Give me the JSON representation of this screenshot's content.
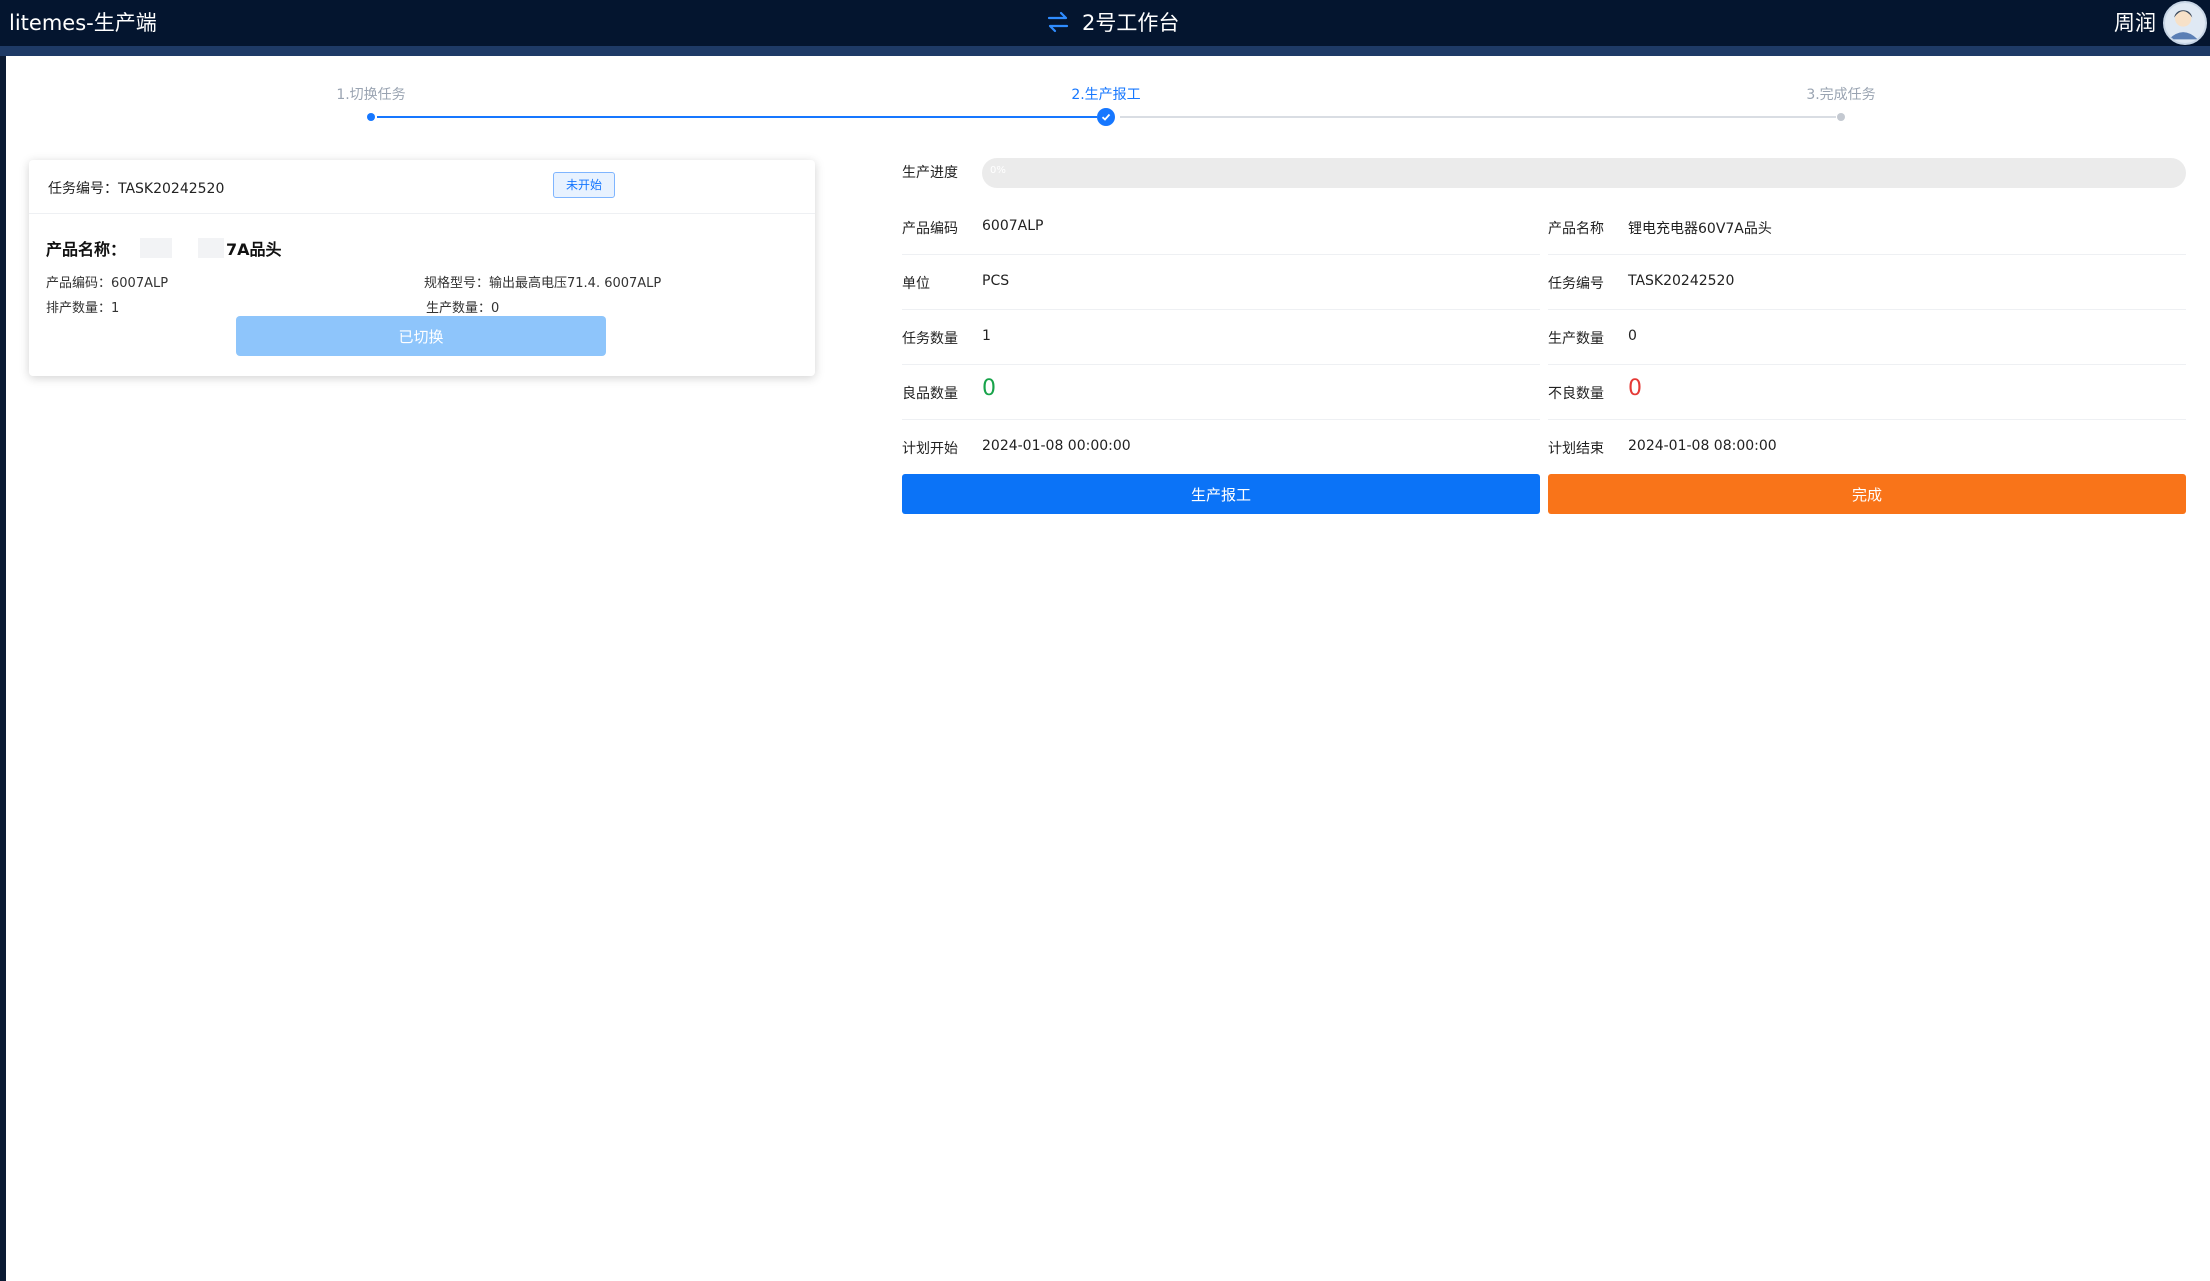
{
  "header": {
    "app_title": "litemes-生产端",
    "workbench": "2号工作台",
    "user_name": "周润"
  },
  "steps": [
    {
      "label": "1.切换任务",
      "state": "done"
    },
    {
      "label": "2.生产报工",
      "state": "active"
    },
    {
      "label": "3.完成任务",
      "state": "todo"
    }
  ],
  "task_card": {
    "task_no": "任务编号：TASK20242520",
    "status": "未开始",
    "product_name_label": "产品名称：",
    "product_name_visible": "7A品头",
    "product_code": "产品编码：6007ALP",
    "spec": "规格型号：输出最高电压71.4. 6007ALP",
    "scheduled_qty": "排产数量：1",
    "produced_qty": "生产数量：0",
    "switch_button": "已切换"
  },
  "detail": {
    "progress_label": "生产进度",
    "progress_value": 0,
    "progress_text": "0%",
    "rows": [
      {
        "l_label": "产品编码",
        "l_value": "6007ALP",
        "r_label": "产品名称",
        "r_value": "锂电充电器60V7A品头"
      },
      {
        "l_label": "单位",
        "l_value": "PCS",
        "r_label": "任务编号",
        "r_value": "TASK20242520"
      },
      {
        "l_label": "任务数量",
        "l_value": "1",
        "r_label": "生产数量",
        "r_value": "0"
      },
      {
        "l_label": "良品数量",
        "l_value": "0",
        "r_label": "不良数量",
        "r_value": "0"
      },
      {
        "l_label": "计划开始",
        "l_value": "2024-01-08 00:00:00",
        "r_label": "计划结束",
        "r_value": "2024-01-08 08:00:00"
      }
    ],
    "report_button": "生产报工",
    "finish_button": "完成"
  },
  "colors": {
    "primary": "#0b73f7",
    "accent_orange": "#f97419",
    "good": "#17a34a",
    "bad": "#e53935",
    "topbar": "#04152f"
  }
}
